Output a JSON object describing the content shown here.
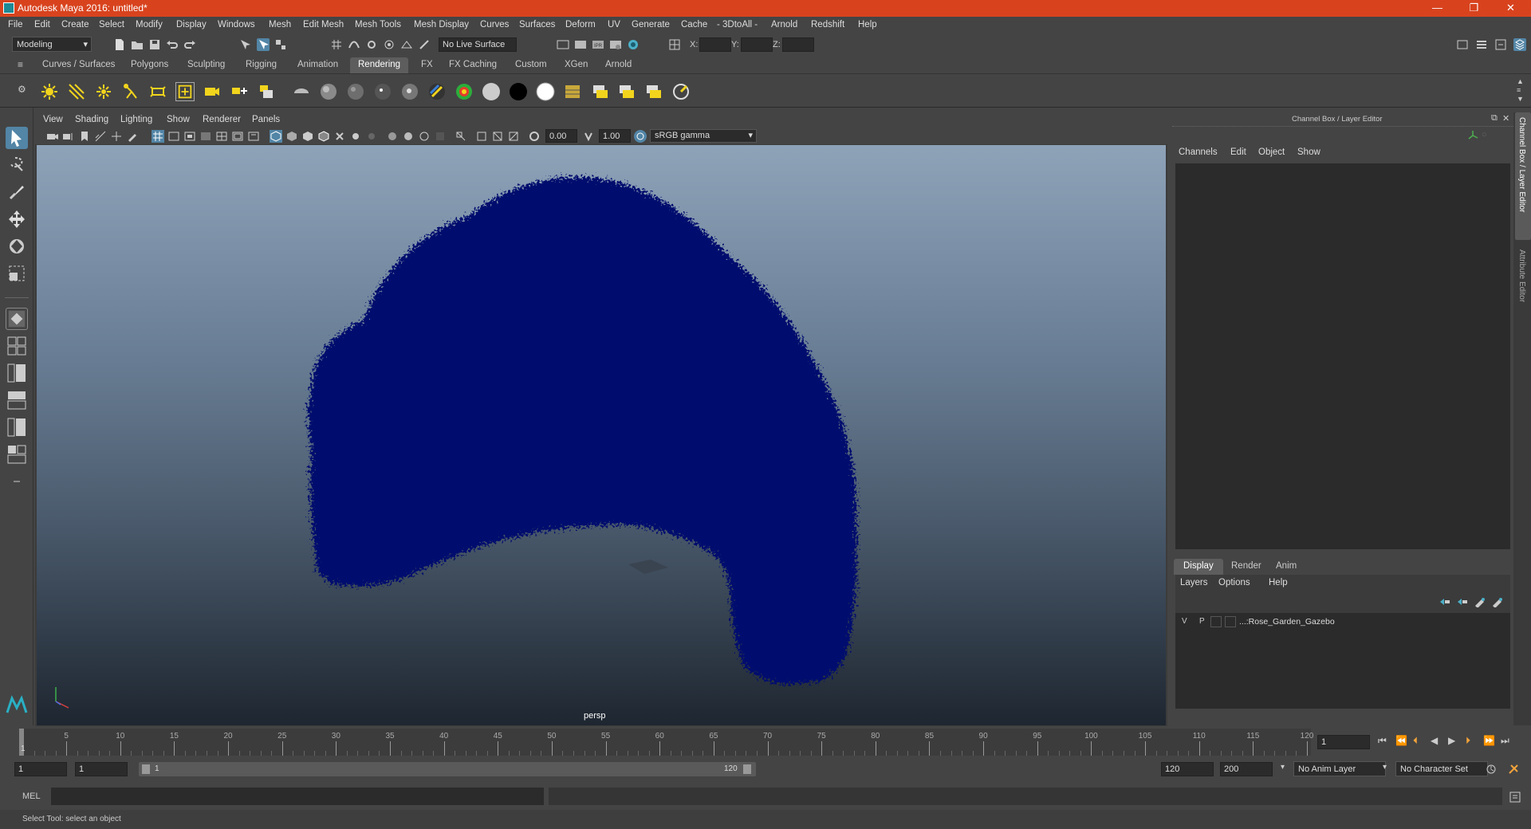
{
  "window": {
    "title": "Autodesk Maya 2016: untitled*",
    "controls": [
      "—",
      "❐",
      "✕"
    ]
  },
  "menubar": [
    "File",
    "Edit",
    "Create",
    "Select",
    "Modify",
    "Display",
    "Windows",
    "Mesh",
    "Edit Mesh",
    "Mesh Tools",
    "Mesh Display",
    "Curves",
    "Surfaces",
    "Deform",
    "UV",
    "Generate",
    "Cache",
    "- 3DtoAll -",
    "Arnold",
    "Redshift",
    "Help"
  ],
  "statusline": {
    "mode": "Modeling",
    "live_surface": "No Live Surface",
    "x_label": "X:",
    "y_label": "Y:",
    "z_label": "Z:"
  },
  "shelf": {
    "tabs": [
      "Curves / Surfaces",
      "Polygons",
      "Sculpting",
      "Rigging",
      "Animation",
      "Rendering",
      "FX",
      "FX Caching",
      "Custom",
      "XGen",
      "Arnold"
    ],
    "active_tab": "Rendering"
  },
  "viewport": {
    "menu": [
      "View",
      "Shading",
      "Lighting",
      "Show",
      "Renderer",
      "Panels"
    ],
    "exposure": "0.00",
    "gamma": "1.00",
    "color_space": "sRGB gamma",
    "camera_label": "persp",
    "object_color": "#000a6e"
  },
  "channel_box": {
    "title": "Channel Box / Layer Editor",
    "menu": [
      "Channels",
      "Edit",
      "Object",
      "Show"
    ]
  },
  "layer_editor": {
    "tabs": [
      "Display",
      "Render",
      "Anim"
    ],
    "active_tab": "Display",
    "menu": [
      "Layers",
      "Options",
      "Help"
    ],
    "layers": [
      {
        "v": "V",
        "p": "P",
        "name": "...:Rose_Garden_Gazebo"
      }
    ]
  },
  "side_tabs": [
    "Channel Box / Layer Editor",
    "Attribute Editor"
  ],
  "timeline": {
    "ticks": [
      "5",
      "10",
      "15",
      "20",
      "25",
      "30",
      "35",
      "40",
      "45",
      "50",
      "55",
      "60",
      "65",
      "70",
      "75",
      "80",
      "85",
      "90",
      "95",
      "100",
      "105",
      "110",
      "115",
      "120"
    ],
    "start_label": "1",
    "current_frame": "1"
  },
  "range": {
    "start": "1",
    "playback_start": "1",
    "slider_start": "1",
    "slider_end": "120",
    "playback_end": "120",
    "end": "200",
    "anim_layer": "No Anim Layer",
    "character_set": "No Character Set"
  },
  "command_line": {
    "label": "MEL"
  },
  "help_line": {
    "text": "Select Tool: select an object"
  }
}
